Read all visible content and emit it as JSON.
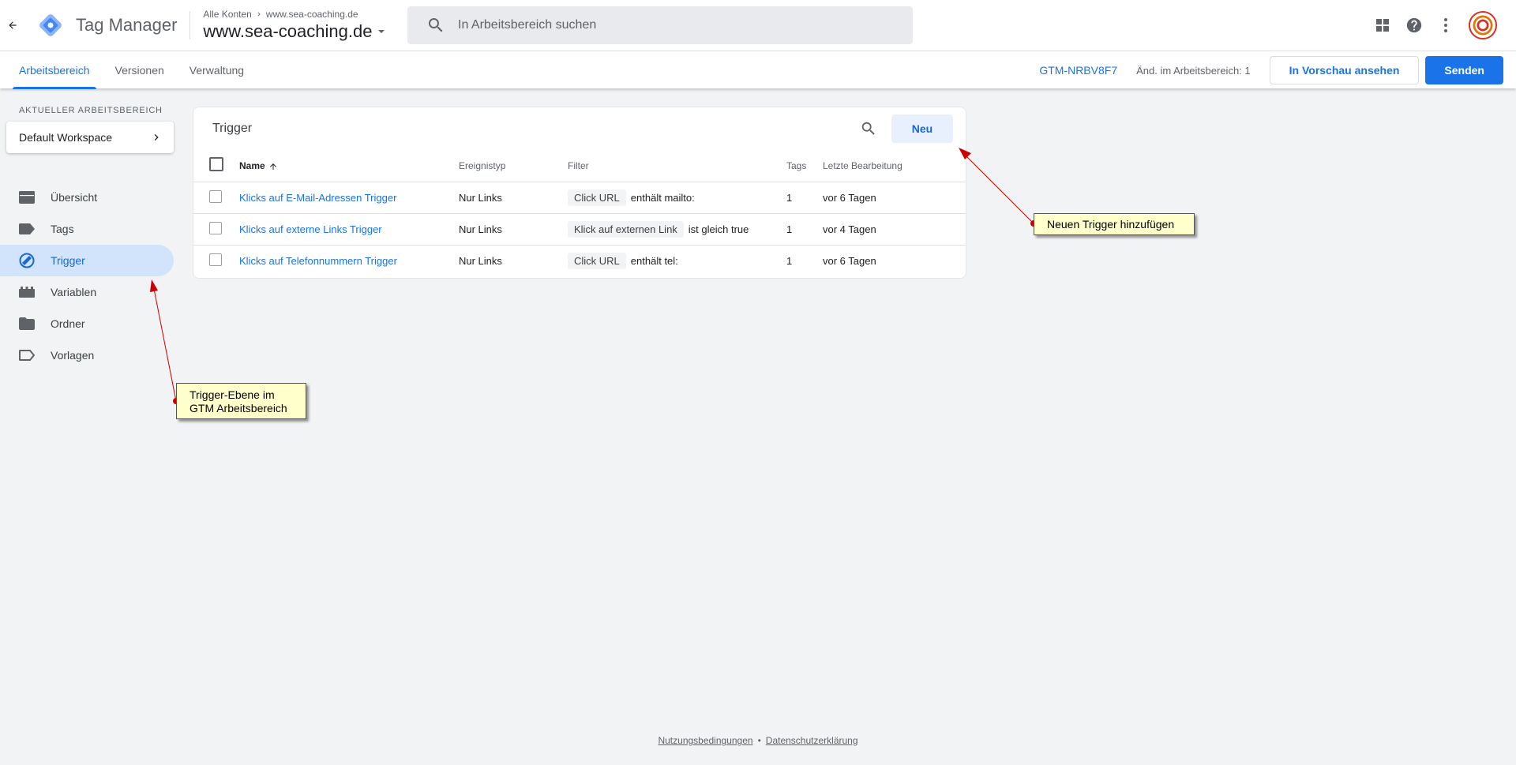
{
  "header": {
    "app_name": "Tag Manager",
    "breadcrumb_root": "Alle Konten",
    "breadcrumb_account": "www.sea-coaching.de",
    "container_name": "www.sea-coaching.de",
    "search_placeholder": "In Arbeitsbereich suchen"
  },
  "tabs": [
    {
      "label": "Arbeitsbereich",
      "active": true
    },
    {
      "label": "Versionen",
      "active": false
    },
    {
      "label": "Verwaltung",
      "active": false
    }
  ],
  "toolbar": {
    "gtm_id": "GTM-NRBV8F7",
    "changes": "Änd. im Arbeitsbereich: 1",
    "preview_label": "In Vorschau ansehen",
    "submit_label": "Senden"
  },
  "sidebar": {
    "workspace_label": "Aktueller Arbeitsbereich",
    "workspace_name": "Default Workspace",
    "items": [
      {
        "label": "Übersicht",
        "icon": "briefcase-icon"
      },
      {
        "label": "Tags",
        "icon": "tag-icon"
      },
      {
        "label": "Trigger",
        "icon": "trigger-icon",
        "active": true
      },
      {
        "label": "Variablen",
        "icon": "variables-icon"
      },
      {
        "label": "Ordner",
        "icon": "folder-icon"
      },
      {
        "label": "Vorlagen",
        "icon": "template-icon"
      }
    ]
  },
  "main": {
    "title": "Trigger",
    "new_label": "Neu",
    "columns": {
      "name": "Name",
      "event_type": "Ereignistyp",
      "filter": "Filter",
      "tags": "Tags",
      "last_edit": "Letzte Bearbeitung"
    },
    "rows": [
      {
        "name": "Klicks auf E-Mail-Adressen Trigger",
        "event_type": "Nur Links",
        "filter_var": "Click URL",
        "filter_op": "enthält mailto:",
        "tags": "1",
        "last_edit": "vor 6 Tagen"
      },
      {
        "name": "Klicks auf externe Links Trigger",
        "event_type": "Nur Links",
        "filter_var": "Klick auf externen Link",
        "filter_op": "ist gleich true",
        "tags": "1",
        "last_edit": "vor 4 Tagen"
      },
      {
        "name": "Klicks auf Telefonnummern Trigger",
        "event_type": "Nur Links",
        "filter_var": "Click URL",
        "filter_op": "enthält tel:",
        "tags": "1",
        "last_edit": "vor 6 Tagen"
      }
    ]
  },
  "annotations": {
    "new_trigger": "Neuen Trigger hinzufügen",
    "trigger_level_line1": "Trigger-Ebene im",
    "trigger_level_line2": "GTM Arbeitsbereich"
  },
  "footer": {
    "terms": "Nutzungsbedingungen",
    "separator": "•",
    "privacy": "Datenschutzerklärung"
  },
  "colors": {
    "accent": "#1a73e8",
    "active_nav_bg": "#d2e3fc",
    "annotation_bg": "#ffffcc",
    "annotation_arrow": "#cc0000"
  }
}
